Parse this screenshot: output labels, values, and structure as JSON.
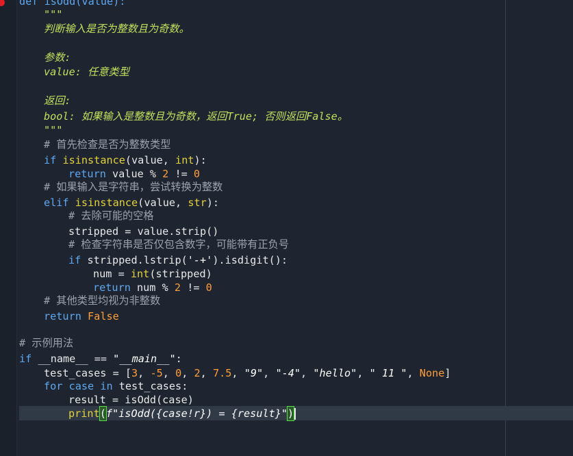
{
  "code": {
    "def_line": "def isOdd(value):",
    "doc_open": "\"\"\"",
    "doc_summary": "判断输入是否为整数且为奇数。",
    "doc_params_label": "参数:",
    "doc_params_value": "value: 任意类型",
    "doc_returns_label": "返回:",
    "doc_returns_value": "bool: 如果输入是整数且为奇数，返回True; 否则返回False。",
    "doc_close": "\"\"\"",
    "comment_check_int": "# 首先检查是否为整数类型",
    "kw_if": "if",
    "fn_isinstance": "isinstance",
    "args_value": "(value, ",
    "type_int": "int",
    "close_colon": "):",
    "kw_return": "return",
    "expr_mod": " value % ",
    "num_2": "2",
    "op_ne": " != ",
    "num_0": "0",
    "comment_if_str": "# 如果输入是字符串，尝试转换为整数",
    "kw_elif": "elif",
    "type_str": "str",
    "comment_strip": "# 去除可能的空格",
    "stripped_assign": "stripped = value.strip()",
    "comment_check_digit": "# 检查字符串是否仅包含数字，可能带有正负号",
    "lstrip_call": " stripped.lstrip(",
    "lstrip_arg": "'-+'",
    "isdigit_call": ").isdigit():",
    "num_assign": "num = ",
    "fn_int": "int",
    "stripped_arg": "(stripped)",
    "expr_num_mod": " num % ",
    "comment_other": "# 其他类型均视为非整数",
    "kw_false": "False",
    "comment_example": "# 示例用法",
    "dunder_name": " __name__ == ",
    "main_str": "\"__main__\"",
    "colon": ":",
    "test_cases_assign": "test_cases = [",
    "tc_3": "3",
    "tc_m5": "-5",
    "tc_0": "0",
    "tc_2": "2",
    "tc_75": "7.5",
    "tc_s9": "\"9\"",
    "tc_sm4": "\"-4\"",
    "tc_hello": "\"hello\"",
    "tc_s11": "\" 11 \"",
    "tc_none": "None",
    "comma": ", ",
    "bracket_close": "]",
    "kw_for": "for",
    "for_case": " case ",
    "kw_in": "in",
    "for_iter": " test_cases:",
    "result_assign": "result = isOdd(case)",
    "fn_print": "print",
    "paren_open": "(",
    "fstring": "f\"isOdd({case!r}) = {result}\"",
    "paren_close": ")"
  },
  "colors": {
    "background": "#1e2530",
    "docstring": "#c3e05c",
    "comment": "#9aa3ad",
    "keyword": "#5fa8f0",
    "builtin": "#e3d23a",
    "number": "#ff9e37",
    "current_line": "#303946",
    "breakpoint": "#e21e26"
  }
}
